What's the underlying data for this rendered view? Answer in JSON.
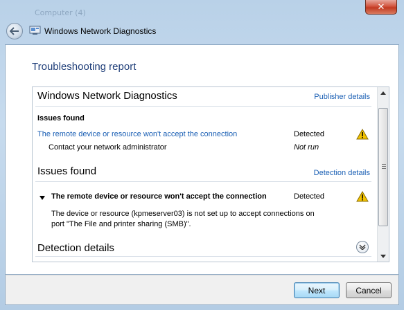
{
  "background_hint": "Computer (4)",
  "window": {
    "title": "Windows Network Diagnostics",
    "close_glyph": "✕",
    "icon": "network-diagnostics-icon"
  },
  "report": {
    "heading": "Troubleshooting report",
    "section1": {
      "title": "Windows Network Diagnostics",
      "link": "Publisher details",
      "subhead": "Issues found",
      "issue_link": "The remote device or resource won't accept the connection",
      "issue_status": "Detected",
      "action": "Contact your network administrator",
      "action_status": "Not run"
    },
    "section2": {
      "title": "Issues found",
      "link": "Detection details",
      "issue_title": "The remote device or resource won't accept the connection",
      "issue_status": "Detected",
      "desc_line1": "The device or resource (kpmeserver03) is not set up to accept connections on",
      "desc_line2": "port \"The File and printer sharing (SMB)\"."
    },
    "section3": {
      "title": "Detection details"
    }
  },
  "buttons": {
    "next": "Next",
    "cancel": "Cancel"
  },
  "colors": {
    "accent_title": "#1e3d78",
    "link": "#1a5fb4",
    "warning": "#f2c200"
  }
}
